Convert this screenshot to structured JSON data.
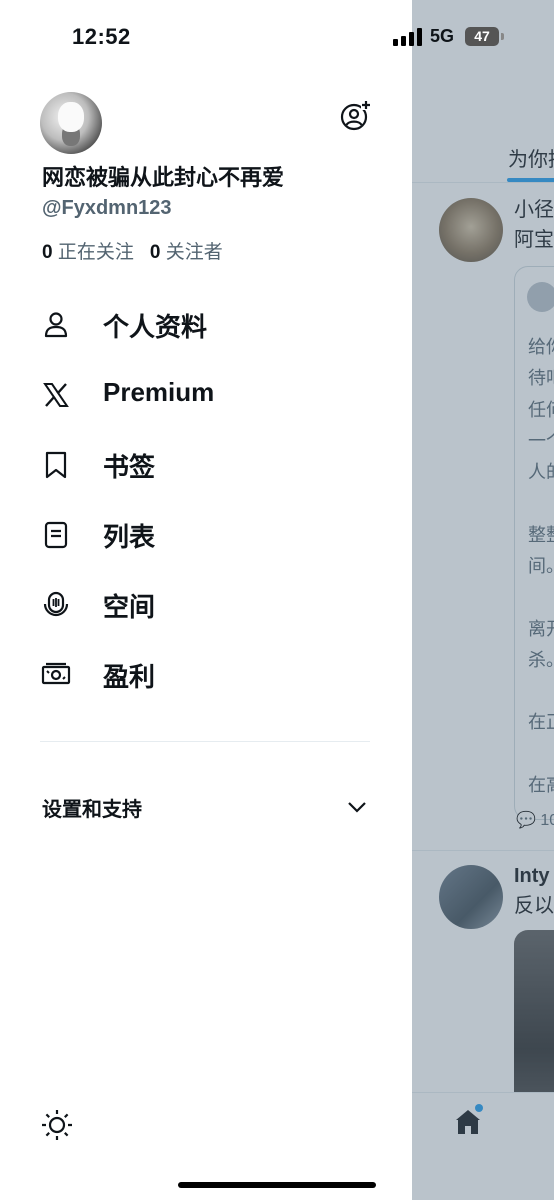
{
  "status_bar": {
    "time": "12:52",
    "network": "5G",
    "battery": "47"
  },
  "profile": {
    "display_name": "网恋被骗从此封心不再爱",
    "handle": "@Fyxdmn123",
    "following_count": "0",
    "following_label": "正在关注",
    "followers_count": "0",
    "followers_label": "关注者"
  },
  "menu": {
    "items": [
      {
        "label": "个人资料",
        "icon": "person-icon"
      },
      {
        "label": "Premium",
        "icon": "x-logo-icon"
      },
      {
        "label": "书签",
        "icon": "bookmark-icon"
      },
      {
        "label": "列表",
        "icon": "list-icon"
      },
      {
        "label": "空间",
        "icon": "spaces-icon"
      },
      {
        "label": "盈利",
        "icon": "monetization-icon"
      }
    ],
    "settings_label": "设置和支持"
  },
  "feed": {
    "tab_label": "为你推",
    "post1": {
      "line1": "小径",
      "line2": "阿宝",
      "quote_lines": [
        "给你",
        "待吧",
        "任何",
        "一个",
        "人的",
        "整整",
        "间。",
        "离开",
        "杀。",
        "在正",
        "在高"
      ],
      "reply_count": "10"
    },
    "post2": {
      "line1": "Inty",
      "line2": "反以"
    }
  },
  "colors": {
    "accent": "#1d9bf0",
    "secondary_text": "#536471",
    "overlay": "#5b7083"
  }
}
